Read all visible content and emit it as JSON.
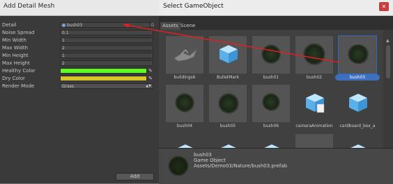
{
  "left_window": {
    "title": "Add Detail Mesh",
    "fields": [
      {
        "label": "Detail",
        "value": "bush03"
      },
      {
        "label": "Noise Spread",
        "value": "0.1"
      },
      {
        "label": "Min Width",
        "value": "1"
      },
      {
        "label": "Max Width",
        "value": "2"
      },
      {
        "label": "Min Height",
        "value": "1"
      },
      {
        "label": "Max Height",
        "value": "2"
      },
      {
        "label": "Healthy Color",
        "color": "#5cff1e"
      },
      {
        "label": "Dry Color",
        "color": "#d6c427"
      },
      {
        "label": "Render Mode",
        "value": "Grass"
      }
    ],
    "add_button": "Add"
  },
  "right_window": {
    "title": "Select GameObject",
    "tabs": [
      "Assets",
      "Scene"
    ],
    "assets": [
      {
        "name": "buildings6",
        "icon": "mesh-preview"
      },
      {
        "name": "BulletMark",
        "icon": "cube-icon"
      },
      {
        "name": "bush01",
        "icon": "bush-preview"
      },
      {
        "name": "bush02",
        "icon": "bush-preview"
      },
      {
        "name": "bush03",
        "icon": "bush-preview"
      },
      {
        "name": "bush04",
        "icon": "bush-preview"
      },
      {
        "name": "bush05",
        "icon": "bush-preview"
      },
      {
        "name": "bush06",
        "icon": "bush-preview"
      },
      {
        "name": "cameraAnimation",
        "icon": "cube-doc-icon"
      },
      {
        "name": "cardboard_box_a",
        "icon": "cube-icon"
      }
    ],
    "selected": "bush03",
    "info": {
      "name": "bush03",
      "type": "Game Object",
      "path": "Assets/Demo03/Nature/bush03.prefab"
    }
  },
  "colors": {
    "accent": "#3d6fbf",
    "close": "#c73c3c",
    "arrow": "#e02020"
  }
}
